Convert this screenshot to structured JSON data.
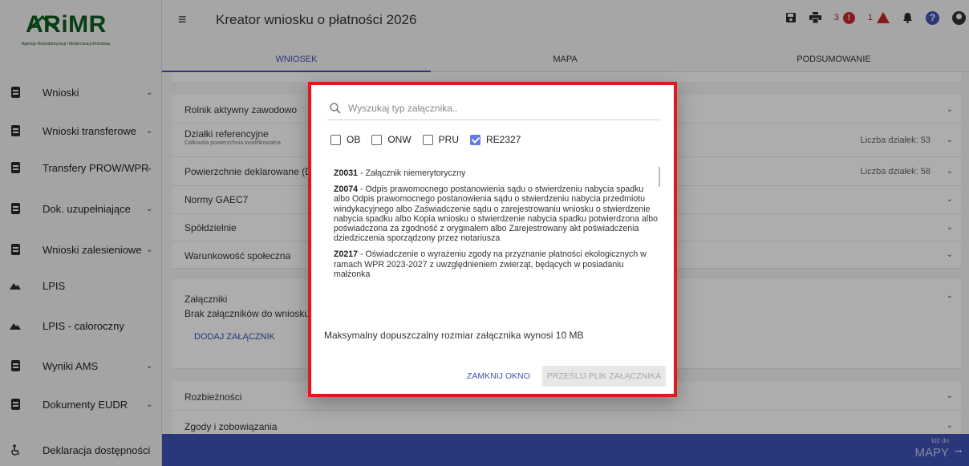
{
  "logo": {
    "name": "ARiMR",
    "subtitle": "Agencja Restrukturyzacji i Modernizacji Rolnictwa"
  },
  "sidebar": {
    "items": [
      {
        "label": "Wnioski",
        "icon": "document-icon",
        "chevron": "⌄"
      },
      {
        "label": "Wnioski transferowe",
        "icon": "document-icon",
        "chevron": "⌄"
      },
      {
        "label": "Transfery PROW/WPR",
        "icon": "document-icon",
        "chevron": "⌄"
      },
      {
        "label": "Dok. uzupełniające",
        "icon": "document-icon",
        "chevron": "⌄"
      },
      {
        "label": "Wnioski zalesieniowe",
        "icon": "document-icon",
        "chevron": "⌄"
      },
      {
        "label": "LPIS",
        "icon": "terrain-icon"
      },
      {
        "label": "LPIS - całoroczny",
        "icon": "terrain-icon"
      },
      {
        "label": "Wyniki AMS",
        "icon": "document-icon",
        "chevron": "⌄"
      },
      {
        "label": "Dokumenty EUDR",
        "icon": "document-icon",
        "chevron": "⌄"
      },
      {
        "label": "Deklaracja dostępności",
        "icon": "accessibility-icon"
      }
    ]
  },
  "header": {
    "title": "Kreator wniosku o płatności 2026",
    "error_count": "3",
    "warning_count": "1"
  },
  "tabs": [
    "WNIOSEK",
    "MAPA",
    "PODSUMOWANIE"
  ],
  "panels": {
    "rolnik": "Rolnik aktywny zawodowo",
    "dzialki": "Działki referencyjne",
    "dzialki_sub": "Całkowita powierzchnia kwalifikowalna",
    "dzialki_count": "Liczba działek: 53",
    "powierzchnie": "Powierzchnie deklarowane (Działki rolne)",
    "powierzchnie_count": "Liczba działek: 58",
    "gaec": "Normy GAEC7",
    "spoldzielnie": "Spółdzielnie",
    "warunkowosc": "Warunkowość społeczna",
    "zalaczniki": "Załączniki",
    "brak": "Brak załączników do wniosku",
    "dodaj": "DODAJ ZAŁĄCZNIK",
    "rozbieznosci": "Rozbieżności",
    "zgody": "Zgody i zobowiązania"
  },
  "bottom": {
    "goto_small": "Idź do",
    "goto_big": "MAPY",
    "arrow": "→"
  },
  "dialog": {
    "search_placeholder": "Wyszukaj typ załącznika..",
    "filters": [
      {
        "label": "OB",
        "checked": false
      },
      {
        "label": "ONW",
        "checked": false
      },
      {
        "label": "PRU",
        "checked": false
      },
      {
        "label": "RE2327",
        "checked": true
      }
    ],
    "attachments": [
      {
        "code": "Z0031",
        "text": " - Załącznik niemerytoryczny"
      },
      {
        "code": "Z0074",
        "text": " - Odpis prawomocnego postanowienia sądu o stwierdzeniu nabycia spadku albo Odpis prawomocnego postanowienia sądu o stwierdzeniu nabycia przedmiotu windykacyjnego albo Zaświadczenie sądu o zarejestrowaniu wniosku o stwierdzenie nabycia spadku albo Kopia wniosku o stwierdzenie nabycia spadku potwierdzona albo poświadczona za zgodność z oryginałem albo Zarejestrowany akt poświadczenia dziedziczenia sporządzony przez notariusza"
      },
      {
        "code": "Z0217",
        "text": " - Oświadczenie o wyrażeniu zgody na przyznanie płatności ekologicznych w ramach WPR 2023-2027 z uwzględnieniem zwierząt, będących w posiadaniu małżonka"
      }
    ],
    "max_size": "Maksymalny dopuszczalny rozmiar załącznika wynosi 10 MB",
    "close_label": "ZAMKNIJ OKNO",
    "upload_label": "PRZEŚLIJ PLIK ZAŁĄCZNIKA"
  },
  "colors": {
    "accent": "#3f51b5",
    "brand_green": "#0d5c1e",
    "error": "#c62828",
    "highlight_border": "#e31818"
  }
}
